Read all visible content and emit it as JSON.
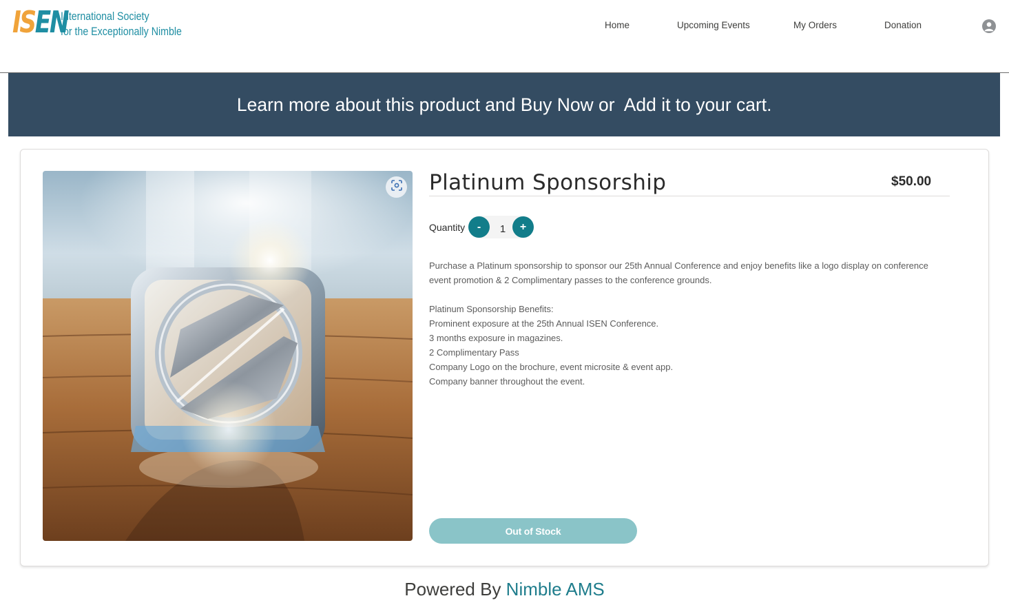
{
  "header": {
    "logo": {
      "mark_part1": "IS",
      "mark_part2": "EN",
      "line1": "International Society",
      "line2": "for the Exceptionally Nimble"
    },
    "nav": [
      {
        "label": "Home"
      },
      {
        "label": "Upcoming Events"
      },
      {
        "label": "My Orders"
      },
      {
        "label": "Donation"
      }
    ],
    "user_icon": "user-avatar-icon"
  },
  "banner": {
    "text": "Learn more about this product and Buy Now or  Add it to your cart."
  },
  "product": {
    "title": "Platinum Sponsorship",
    "price": "$50.00",
    "quantity_label": "Quantity",
    "quantity_value": "1",
    "decrement_label": "-",
    "increment_label": "+",
    "zoom_icon": "zoom-focus-icon",
    "description": [
      "Purchase a Platinum sponsorship to sponsor our 25th Annual Conference and enjoy benefits like a logo display on conference event promotion & 2 Complimentary passes to the conference grounds."
    ],
    "benefits_heading": "Platinum Sponsorship Benefits:",
    "benefits": [
      "Prominent exposure at the 25th Annual ISEN Conference.",
      "3 months exposure in magazines.",
      "2 Complimentary Pass",
      "Company Logo on the brochure, event microsite & event app.",
      "Company banner throughout the event."
    ],
    "stock_button": "Out of Stock"
  },
  "footer": {
    "prefix": "Powered By ",
    "brand": "Nimble AMS"
  },
  "colors": {
    "banner_bg": "#344c62",
    "accent_teal": "#127d8a",
    "disabled_button": "#8ac4c8",
    "logo_orange": "#f0a33a",
    "logo_teal": "#1f8ea3"
  }
}
